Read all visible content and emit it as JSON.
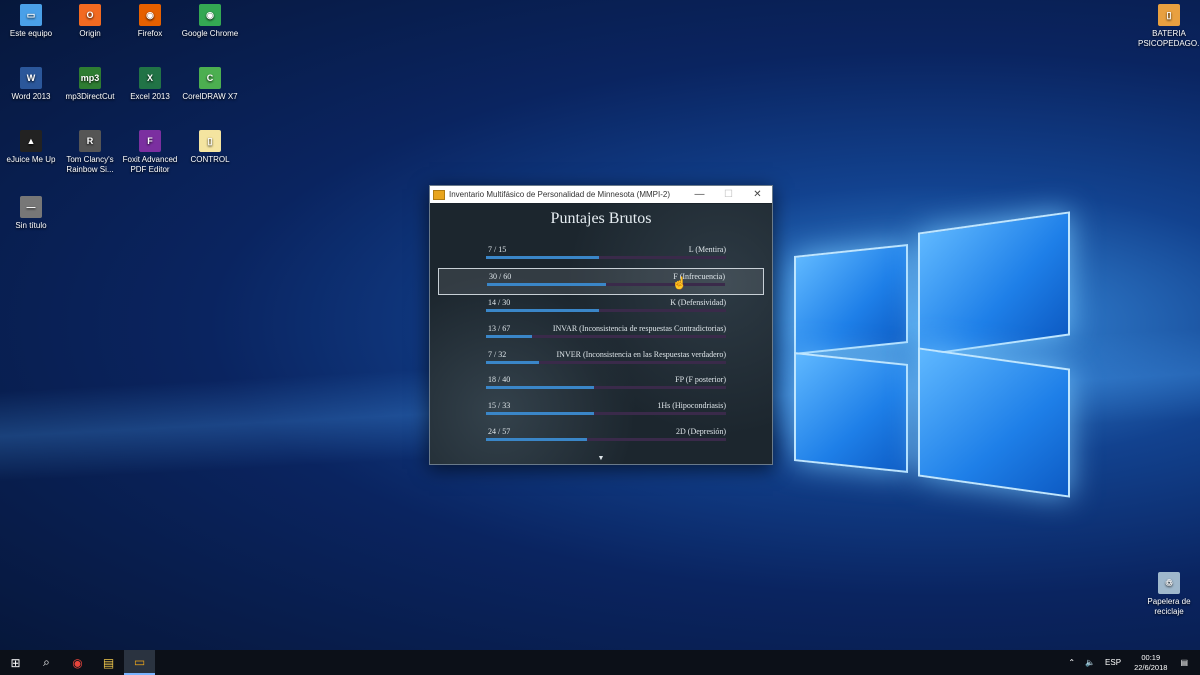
{
  "desktop": {
    "icons": [
      {
        "label": "Este equipo",
        "glyph": "▭",
        "color": "#4aa0e8"
      },
      {
        "label": "Origin",
        "glyph": "O",
        "color": "#f26a21"
      },
      {
        "label": "Firefox",
        "glyph": "◉",
        "color": "#e66000"
      },
      {
        "label": "Google Chrome",
        "glyph": "◉",
        "color": "#34a853"
      },
      {
        "label": "Word 2013",
        "glyph": "W",
        "color": "#2b579a"
      },
      {
        "label": "mp3DirectCut",
        "glyph": "mp3",
        "color": "#2e7d32"
      },
      {
        "label": "Excel 2013",
        "glyph": "X",
        "color": "#217346"
      },
      {
        "label": "CorelDRAW X7",
        "glyph": "C",
        "color": "#4caf50"
      },
      {
        "label": "eJuice Me Up",
        "glyph": "▲",
        "color": "#222222"
      },
      {
        "label": "Tom Clancy's Rainbow Si...",
        "glyph": "R",
        "color": "#555555"
      },
      {
        "label": "Foxit Advanced PDF Editor",
        "glyph": "F",
        "color": "#7b2fa0"
      },
      {
        "label": "CONTROL",
        "glyph": "▯",
        "color": "#f4e4a0"
      },
      {
        "label": "Sin título",
        "glyph": "—",
        "color": "#777777"
      },
      {
        "label": "BATERIA PSICOPEDAGO...",
        "glyph": "▯",
        "color": "#e8a040"
      },
      {
        "label": "Papelera de reciclaje",
        "glyph": "♲",
        "color": "#9fb8cc"
      }
    ]
  },
  "window": {
    "title": "Inventario Multifásico de Personalidad de Minnesota (MMPI-2)",
    "minimize": "—",
    "maximize": "☐",
    "close": "✕",
    "heading": "Puntajes Brutos",
    "more_indicator": "▼",
    "rows": [
      {
        "score": "7 / 15",
        "scale": "L (Mentira)",
        "fraction": 0.47
      },
      {
        "score": "30 / 60",
        "scale": "F (Infrecuencia)",
        "fraction": 0.5,
        "selected": true
      },
      {
        "score": "14 / 30",
        "scale": "K (Defensividad)",
        "fraction": 0.47
      },
      {
        "score": "13 / 67",
        "scale": "INVAR (Inconsistencia de respuestas Contradictorias)",
        "fraction": 0.19
      },
      {
        "score": "7 / 32",
        "scale": "INVER (Inconsistencia en las Respuestas verdadero)",
        "fraction": 0.22
      },
      {
        "score": "18 / 40",
        "scale": "FP (F posterior)",
        "fraction": 0.45
      },
      {
        "score": "15 / 33",
        "scale": "1Hs (Hipocondriasis)",
        "fraction": 0.45
      },
      {
        "score": "24 / 57",
        "scale": "2D (Depresión)",
        "fraction": 0.42
      }
    ]
  },
  "taskbar": {
    "start": "⊞",
    "search": "⌕",
    "chrome": "◉",
    "explorer": "▤",
    "active_app": "▭",
    "tray_chevron": "⌃",
    "volume": "🔈",
    "language": "ESP",
    "time": "00:19",
    "date": "22/6/2018",
    "notifications": "▤"
  }
}
